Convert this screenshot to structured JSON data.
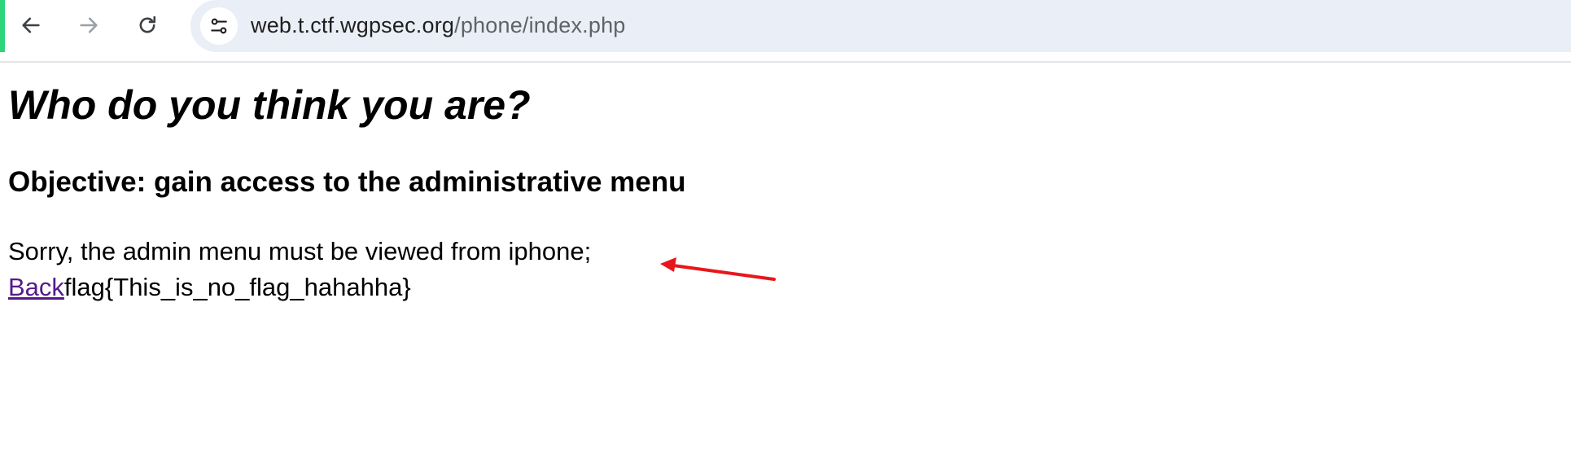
{
  "browser": {
    "back_icon": "arrow-left-icon",
    "forward_icon": "arrow-right-icon",
    "reload_icon": "reload-icon",
    "site_info_icon": "tune-icon",
    "url_host": "web.t.ctf.wgpsec.org",
    "url_path": "/phone/index.php",
    "accent_color": "#2ed47a",
    "omnibox_color": "#eaeef6"
  },
  "page": {
    "title": "Who do you think you are?",
    "objective": "Objective: gain access to the administrative menu",
    "message": "Sorry, the admin menu must be viewed from iphone;",
    "back_link": "Back",
    "flag_text": "flag{This_is_no_flag_hahahha}",
    "link_color": "#551a8b"
  },
  "annotation": {
    "arrow_color": "#e8161c"
  }
}
